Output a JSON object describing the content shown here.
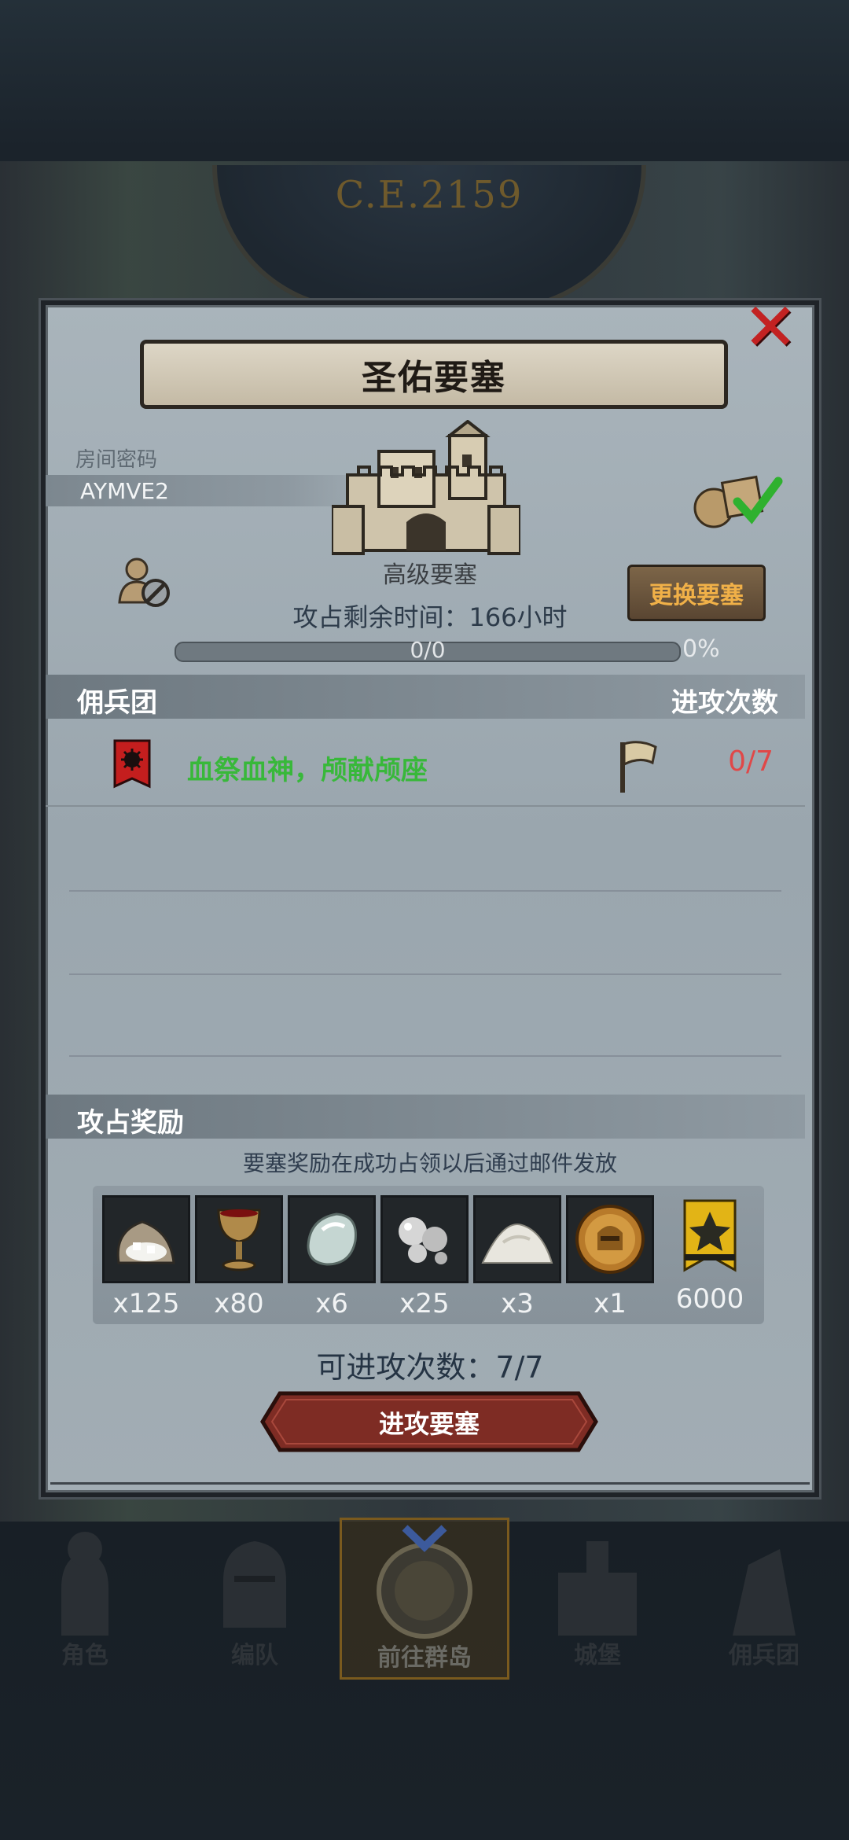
{
  "background": {
    "year_label": "C.E.2159"
  },
  "modal": {
    "title": "圣佑要塞",
    "room_password_label": "房间密码",
    "room_code": "AYMVE2",
    "fortress_rank": "高级要塞",
    "change_button": "更换要塞",
    "time_remaining": "攻占剩余时间：166小时",
    "progress": {
      "text": "0/0",
      "percent_label": "0%",
      "fraction": 0
    },
    "mercenary_section": {
      "left_header": "佣兵团",
      "right_header": "进攻次数",
      "rows": [
        {
          "name": "血祭血神，颅献颅座",
          "attacks": "0/7"
        }
      ]
    },
    "rewards_section": {
      "header": "攻占奖励",
      "notice": "要塞奖励在成功占领以后通过邮件发放",
      "items": [
        {
          "icon": "salt-sack-icon",
          "qty": "x125"
        },
        {
          "icon": "goblet-icon",
          "qty": "x80"
        },
        {
          "icon": "moonstone-icon",
          "qty": "x6"
        },
        {
          "icon": "pearls-icon",
          "qty": "x25"
        },
        {
          "icon": "powder-pile-icon",
          "qty": "x3"
        },
        {
          "icon": "knight-coin-icon",
          "qty": "x1"
        },
        {
          "icon": "gold-banner-icon",
          "qty": "6000"
        }
      ]
    },
    "attempts_text": "可进攻次数：7/7",
    "attack_button": "进攻要塞"
  },
  "nav": {
    "items": [
      {
        "label": "角色"
      },
      {
        "label": "编队"
      },
      {
        "label": "前往群岛"
      },
      {
        "label": "城堡"
      },
      {
        "label": "佣兵团"
      }
    ]
  },
  "colors": {
    "close": "#c32222",
    "merc_name": "#38b83a",
    "attack_count": "#e04848",
    "change_button_text": "#f0b048"
  }
}
